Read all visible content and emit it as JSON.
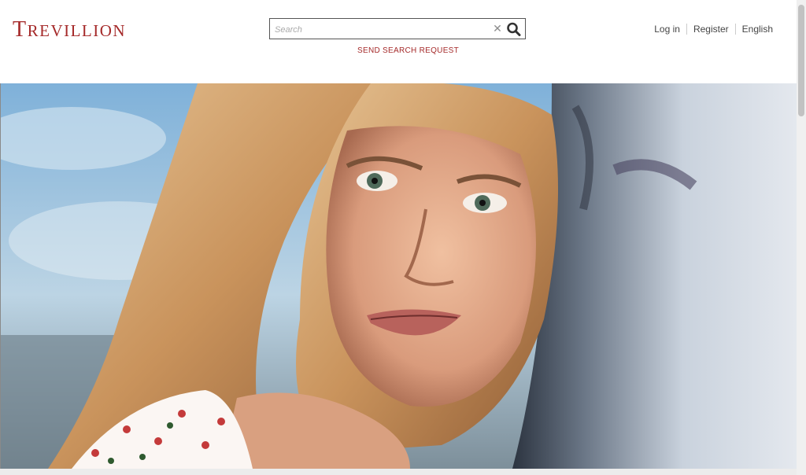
{
  "brand": {
    "logo_first": "T",
    "logo_rest": "REVILLION",
    "accent_color": "#a52a2a"
  },
  "search": {
    "placeholder": "Search",
    "clear_icon": "close-icon",
    "submit_icon": "search-icon",
    "send_request_label": "SEND SEARCH REQUEST"
  },
  "nav": {
    "login": "Log in",
    "register": "Register",
    "language": "English"
  },
  "hero": {
    "subject": "portrait-photo"
  }
}
